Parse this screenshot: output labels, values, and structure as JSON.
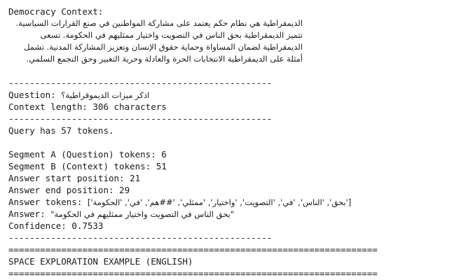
{
  "console": {
    "context_header": "Democracy Context:",
    "context_lines": [
      "الديمقراطية هي نظام حكم يعتمد على مشاركة المواطنين في صنع القرارات السياسية.",
      "تتميز الديمقراطية بحق الناس في التصويت واختيار ممثليهم في الحكومة. تسعى",
      "الديمقراطية لضمان المساواة وحماية حقوق الإنسان وتعزيز المشاركة المدنية. تشمل",
      "أمثلة على الديمقراطية الانتخابات الحرة والعادلة وحرية التعبير وحق التجمع السلمي."
    ],
    "dash_rule": "--------------------------------------------------",
    "question_label": "Question: ",
    "question_text": "اذكر ميزات الديموقراطية؟",
    "context_length_line": "Context length: 306 characters",
    "query_tokens_line": "Query has 57 tokens.",
    "segment_a_line": "Segment A (Question) tokens: 6",
    "segment_b_line": "Segment B (Context) tokens: 51",
    "answer_start_line": "Answer start position: 21",
    "answer_end_line": "Answer end position: 29",
    "answer_tokens_label": "Answer tokens: ",
    "answer_tokens_value": "['بحق', 'الناس', 'في', 'التصويت', 'واختيار', 'ممثلي', '##هم', 'في', 'الحكومة']",
    "answer_label": "Answer: ",
    "answer_value": "\"بحق الناس في التصويت واختيار ممثليهم في الحكومة\"",
    "confidence_line": "Confidence: 0.7533",
    "eq_rule": "======================================================================",
    "section_title": "SPACE EXPLORATION EXAMPLE (ENGLISH)"
  }
}
